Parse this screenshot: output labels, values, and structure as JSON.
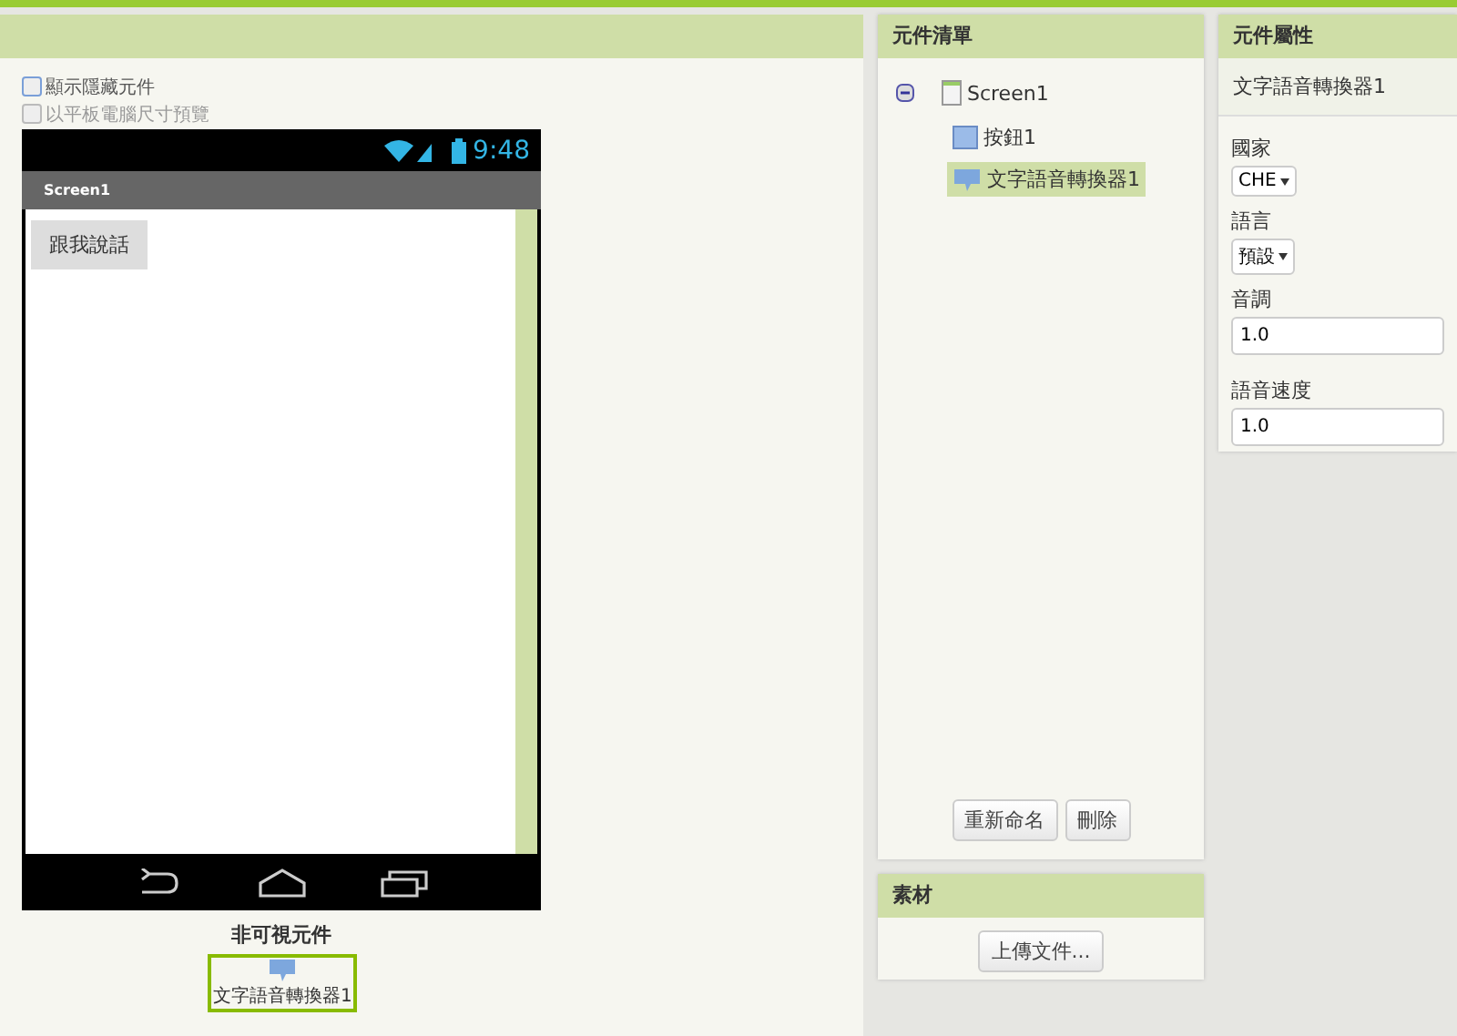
{
  "viewer": {
    "options": [
      {
        "label": "顯示隱藏元件",
        "checked": false,
        "disabled": false
      },
      {
        "label": "以平板電腦尺寸預覽",
        "checked": false,
        "disabled": true
      }
    ],
    "phone": {
      "time": "9:48",
      "title": "Screen1",
      "button": "跟我說話"
    },
    "nonvisible": {
      "title": "非可視元件",
      "items": [
        {
          "label": "文字語音轉換器1",
          "selected": true
        }
      ]
    }
  },
  "components": {
    "title": "元件清單",
    "tree": [
      {
        "label": "Screen1",
        "kind": "screen",
        "expanded": true,
        "selected": false,
        "children": [
          {
            "label": "按鈕1",
            "kind": "button",
            "selected": false
          },
          {
            "label": "文字語音轉換器1",
            "kind": "speech",
            "selected": true
          }
        ]
      }
    ],
    "buttons": [
      "重新命名",
      "刪除"
    ]
  },
  "assets": {
    "title": "素材",
    "button": "上傳文件..."
  },
  "properties": {
    "title": "元件屬性",
    "component": "文字語音轉換器1",
    "fields": [
      {
        "label": "國家",
        "kind": "dropdown",
        "value": "CHE"
      },
      {
        "label": "語言",
        "kind": "dropdown",
        "value": "預設"
      },
      {
        "label": "音調",
        "kind": "text",
        "value": "1.0"
      },
      {
        "label": "語音速度",
        "kind": "text",
        "value": "1.0"
      }
    ]
  }
}
